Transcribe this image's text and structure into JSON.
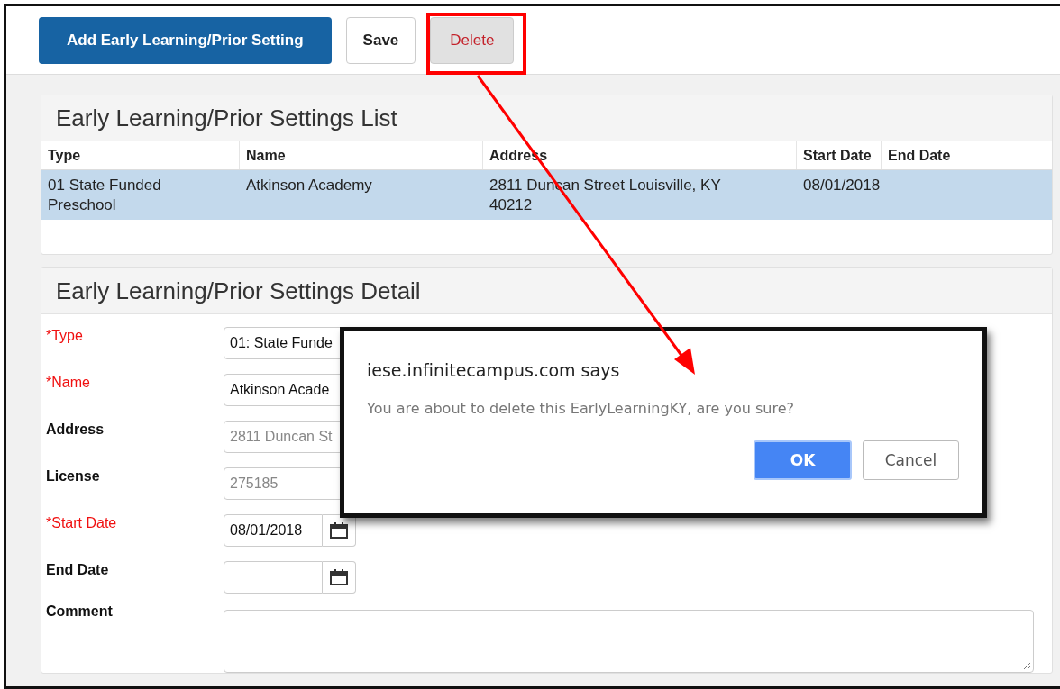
{
  "toolbar": {
    "buttons": [
      {
        "label": "Add Early Learning/Prior Setting",
        "kind": "primary"
      },
      {
        "label": "Save",
        "kind": "default"
      },
      {
        "label": "Delete",
        "kind": "delete"
      }
    ]
  },
  "list_panel": {
    "title": "Early Learning/Prior Settings List",
    "columns": [
      "Type",
      "Name",
      "Address",
      "Start Date",
      "End Date"
    ],
    "rows": [
      {
        "selected": true,
        "cells": [
          "01 State Funded Preschool",
          "Atkinson Academy",
          "2811 Duncan Street Louisville, KY 40212",
          "08/01/2018",
          ""
        ]
      }
    ]
  },
  "detail_panel": {
    "title": "Early Learning/Prior Settings Detail",
    "fields": [
      {
        "label": "*Type",
        "required": true,
        "kind": "wide",
        "value": "01: State Funde",
        "disabled": false
      },
      {
        "label": "*Name",
        "required": true,
        "kind": "wide",
        "value": "Atkinson Acade",
        "disabled": false
      },
      {
        "label": "Address",
        "required": false,
        "kind": "wide",
        "value": "2811 Duncan St",
        "disabled": true
      },
      {
        "label": "License",
        "required": false,
        "kind": "short",
        "value": "275185",
        "disabled": true
      },
      {
        "label": "*Start Date",
        "required": true,
        "kind": "date",
        "value": "08/01/2018",
        "disabled": false
      },
      {
        "label": "End Date",
        "required": false,
        "kind": "date"
      },
      {
        "label": "Comment",
        "required": false,
        "kind": "textarea"
      }
    ]
  },
  "dialog": {
    "title": "iese.infinitecampus.com says",
    "message": "You are about to delete this EarlyLearningKY, are you sure?",
    "buttons": [
      {
        "label": "OK",
        "kind": "primary"
      },
      {
        "label": "Cancel",
        "kind": "default"
      }
    ]
  }
}
